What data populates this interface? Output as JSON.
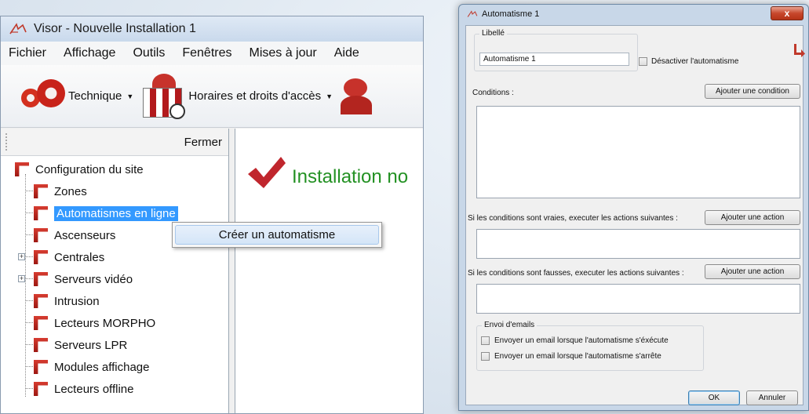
{
  "main_window": {
    "title": "Visor - Nouvelle Installation 1",
    "menu": [
      "Fichier",
      "Affichage",
      "Outils",
      "Fenêtres",
      "Mises à jour",
      "Aide"
    ],
    "toolbar": {
      "technique_label": "Technique",
      "horaires_label": "Horaires et droits d'accès"
    },
    "left_panel": {
      "close_label": "Fermer",
      "root": "Configuration du site",
      "items": [
        "Zones",
        "Automatismes en ligne",
        "Ascenseurs",
        "Centrales",
        "Serveurs vidéo",
        "Intrusion",
        "Lecteurs MORPHO",
        "Serveurs LPR",
        "Modules affichage",
        "Lecteurs offline"
      ],
      "selected": "Automatismes en ligne"
    },
    "content_message": "Installation no",
    "context_menu": {
      "item": "Créer un automatisme"
    }
  },
  "dialog": {
    "title": "Automatisme 1",
    "close_label": "x",
    "libelle_legend": "Libellé",
    "libelle_value": "Automatisme 1",
    "disable_label": "Désactiver l'automatisme",
    "conditions_label": "Conditions :",
    "add_condition": "Ajouter une condition",
    "true_label": "Si les conditions sont vraies, executer les actions suivantes :",
    "false_label": "Si les conditions sont fausses, executer les actions suivantes :",
    "add_action": "Ajouter une action",
    "email_legend": "Envoi d'emails",
    "email_on_run": "Envoyer un email lorsque l'automatisme s'éxécute",
    "email_on_stop": "Envoyer un email lorsque l'automatisme s'arrête",
    "ok": "OK",
    "cancel": "Annuler"
  },
  "colors": {
    "accent_red": "#c8231a",
    "success_green": "#239123",
    "selection_blue": "#3399ff"
  }
}
